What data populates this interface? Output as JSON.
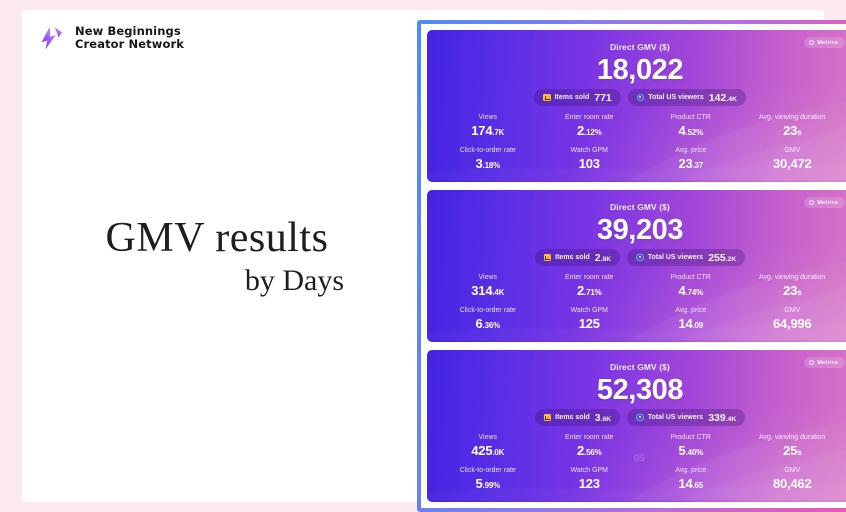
{
  "brand": {
    "name": "New Beginnings\nCreator Network",
    "logo_icon": "lightning-bolt-logo-icon"
  },
  "headline": {
    "line1": "GMV results",
    "line2": "by Days"
  },
  "theme": {
    "outer_background": "#fce8ef",
    "page_background": "#ffffff",
    "frame_gradient_start": "#4d8bf5",
    "frame_gradient_end": "#ef56b0",
    "card_gradient_start": "#4324e2",
    "card_gradient_end": "#d774c6",
    "cart_icon_color": "#ffb733",
    "eye_icon_color": "#36c6f4"
  },
  "cards": [
    {
      "badge": {
        "label": "Metrics",
        "icon": "gear-icon"
      },
      "title": "Direct GMV ($)",
      "hero": "18,022",
      "pills": [
        {
          "icon": "cart-icon",
          "label": "Items sold",
          "value": "771",
          "suffix": ""
        },
        {
          "icon": "eye-icon",
          "label": "Total US viewers",
          "value": "142",
          "suffix": ".4K"
        }
      ],
      "metrics": [
        {
          "label": "Views",
          "value": "174",
          "suffix": ".7K"
        },
        {
          "label": "Enter room rate",
          "value": "2",
          "suffix": ".12%"
        },
        {
          "label": "Product CTR",
          "value": "4",
          "suffix": ".52%"
        },
        {
          "label": "Avg. viewing duration",
          "value": "23",
          "suffix": "s"
        },
        {
          "label": "Click-to-order rate",
          "value": "3",
          "suffix": ".18%"
        },
        {
          "label": "Watch GPM",
          "value": "103",
          "suffix": ""
        },
        {
          "label": "Avg. price",
          "value": "23",
          "suffix": ".37"
        },
        {
          "label": "GMV",
          "value": "30,472",
          "suffix": ""
        }
      ],
      "watermark": ""
    },
    {
      "badge": {
        "label": "Metrics",
        "icon": "gear-icon"
      },
      "title": "Direct GMV ($)",
      "hero": "39,203",
      "pills": [
        {
          "icon": "cart-icon",
          "label": "Items sold",
          "value": "2",
          "suffix": ".8K"
        },
        {
          "icon": "eye-icon",
          "label": "Total US viewers",
          "value": "255",
          "suffix": ".2K"
        }
      ],
      "metrics": [
        {
          "label": "Views",
          "value": "314",
          "suffix": ".4K"
        },
        {
          "label": "Enter room rate",
          "value": "2",
          "suffix": ".71%"
        },
        {
          "label": "Product CTR",
          "value": "4",
          "suffix": ".74%"
        },
        {
          "label": "Avg. viewing duration",
          "value": "23",
          "suffix": "s"
        },
        {
          "label": "Click-to-order rate",
          "value": "6",
          "suffix": ".36%"
        },
        {
          "label": "Watch GPM",
          "value": "125",
          "suffix": ""
        },
        {
          "label": "Avg. price",
          "value": "14",
          "suffix": ".09"
        },
        {
          "label": "GMV",
          "value": "64,996",
          "suffix": ""
        }
      ],
      "watermark": ""
    },
    {
      "badge": {
        "label": "Metrics",
        "icon": "gear-icon"
      },
      "title": "Direct GMV ($)",
      "hero": "52,308",
      "pills": [
        {
          "icon": "cart-icon",
          "label": "Items sold",
          "value": "3",
          "suffix": ".6K"
        },
        {
          "icon": "eye-icon",
          "label": "Total US viewers",
          "value": "339",
          "suffix": ".4K"
        }
      ],
      "metrics": [
        {
          "label": "Views",
          "value": "425",
          "suffix": ".0K"
        },
        {
          "label": "Enter room rate",
          "value": "2",
          "suffix": ".56%"
        },
        {
          "label": "Product CTR",
          "value": "5",
          "suffix": ".40%"
        },
        {
          "label": "Avg. viewing duration",
          "value": "25",
          "suffix": "s"
        },
        {
          "label": "Click-to-order rate",
          "value": "5",
          "suffix": ".99%"
        },
        {
          "label": "Watch GPM",
          "value": "123",
          "suffix": ""
        },
        {
          "label": "Avg. price",
          "value": "14",
          "suffix": ".65"
        },
        {
          "label": "GMV",
          "value": "80,462",
          "suffix": ""
        }
      ],
      "watermark": "05"
    }
  ]
}
